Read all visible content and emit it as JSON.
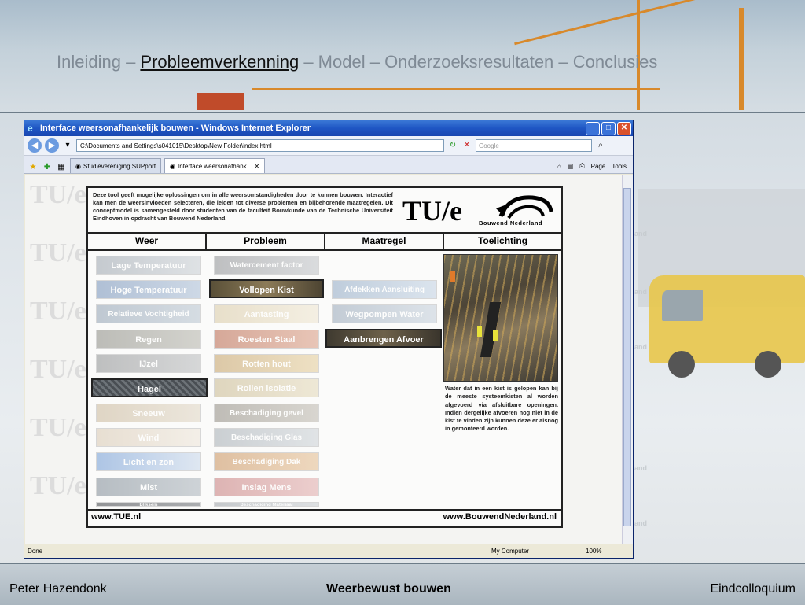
{
  "slide": {
    "nav": {
      "items": [
        "Inleiding",
        "Probleemverkenning",
        "Model",
        "Onderzoeksresultaten",
        "Conclusies"
      ],
      "separator": " – ",
      "current_index": 1
    },
    "footer": {
      "left": "Peter Hazendonk",
      "center": "Weerbewust bouwen",
      "right": "Eindcolloquium"
    }
  },
  "browser": {
    "title": "Interface weersonafhankelijk bouwen - Windows Internet Explorer",
    "address": "C:\\Documents and Settings\\s041015\\Desktop\\New Folder\\index.html",
    "search_placeholder": "Google",
    "tabs": [
      {
        "label": "Studievereniging SUPport",
        "active": false
      },
      {
        "label": "Interface weersonafhank...",
        "active": true
      }
    ],
    "toolbar": {
      "page": "Page",
      "tools": "Tools"
    },
    "status": {
      "text": "Done",
      "zone": "My Computer",
      "zoom": "100%"
    }
  },
  "webpage": {
    "intro": "Deze tool geeft mogelijke oplossingen om in alle weersomstandigheden door te kunnen bouwen. Interactief kan men de weersinvloeden selecteren, die leiden tot diverse problemen en bijbehorende maatregelen. Dit conceptmodel is samengesteld door studenten van de faculteit Bouwkunde van de Technische Universiteit Eindhoven in opdracht van Bouwend Nederland.",
    "logo_tue": "TU/e",
    "logo_bn": "Bouwend Nederland",
    "columns": [
      "Weer",
      "Probleem",
      "Maatregel",
      "Toelichting"
    ],
    "weer": [
      "Lage Temperatuur",
      "Hoge Temperatuur",
      "Relatieve Vochtigheid",
      "Regen",
      "IJzel",
      "Hagel",
      "Sneeuw",
      "Wind",
      "Licht en zon",
      "Mist",
      "Bliksem"
    ],
    "probleem": [
      "Watercement factor",
      "Vollopen Kist",
      "Aantasting",
      "Roesten Staal",
      "Rotten hout",
      "Rollen isolatie",
      "Beschadiging gevel",
      "Beschadiging Glas",
      "Beschadiging Dak",
      "Inslag Mens",
      "Beschadiging Materiaal"
    ],
    "maatregel": [
      "Afdekken Aansluiting",
      "Wegpompen Water",
      "Aanbrengen Afvoer"
    ],
    "selected": {
      "weer": "Hagel",
      "probleem": "Vollopen Kist",
      "maatregel": "Aanbrengen Afvoer"
    },
    "toelichting": "Water dat in een kist is gelopen kan bij de meeste systeemkisten al worden afgevoerd via afsluitbare openingen. Indien dergelijke afvoeren nog niet in de kist te vinden zijn kunnen deze er alsnog in gemonteerd worden.",
    "url_left": "www.TUE.nl",
    "url_right": "www.BouwendNederland.nl"
  },
  "colors": {
    "accent_blue": "#1f56c4",
    "border": "#222222",
    "crane": "#d8892b"
  }
}
